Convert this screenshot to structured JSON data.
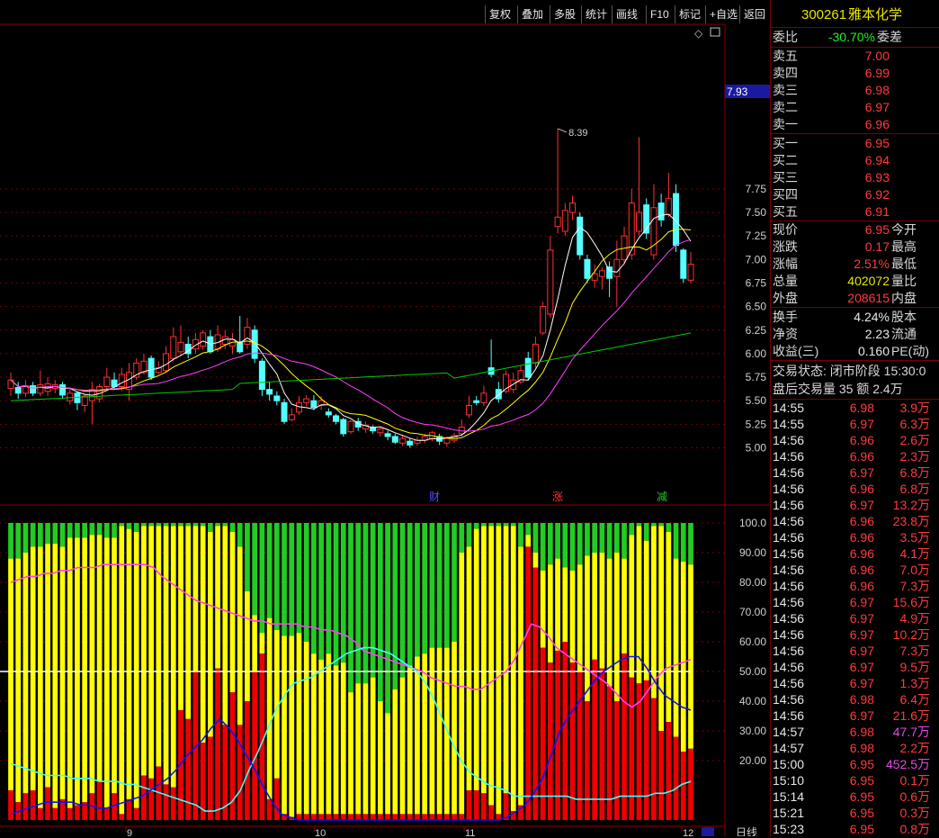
{
  "toolbar": {
    "buttons": [
      "复权",
      "叠加",
      "多股",
      "统计",
      "画线",
      "F10",
      "标记",
      "+自选",
      "返回"
    ]
  },
  "stock": {
    "code": "300261",
    "name": "雅本化学"
  },
  "quote": {
    "weibi_label": "委比",
    "weibi_value": "-30.70%",
    "weicha_label": "委差",
    "asks": [
      {
        "label": "卖五",
        "price": "7.00"
      },
      {
        "label": "卖四",
        "price": "6.99"
      },
      {
        "label": "卖三",
        "price": "6.98"
      },
      {
        "label": "卖二",
        "price": "6.97"
      },
      {
        "label": "卖一",
        "price": "6.96"
      }
    ],
    "bids": [
      {
        "label": "买一",
        "price": "6.95"
      },
      {
        "label": "买二",
        "price": "6.94"
      },
      {
        "label": "买三",
        "price": "6.93"
      },
      {
        "label": "买四",
        "price": "6.92"
      },
      {
        "label": "买五",
        "price": "6.91"
      }
    ],
    "stats1": [
      {
        "label": "现价",
        "value": "6.95",
        "label2": "今开",
        "cls": "red"
      },
      {
        "label": "涨跌",
        "value": "0.17",
        "label2": "最高",
        "cls": "red"
      },
      {
        "label": "涨幅",
        "value": "2.51%",
        "label2": "最低",
        "cls": "red"
      },
      {
        "label": "总量",
        "value": "402072",
        "label2": "量比",
        "cls": "yellow"
      },
      {
        "label": "外盘",
        "value": "208615",
        "label2": "内盘",
        "cls": "red"
      }
    ],
    "stats2": [
      {
        "label": "换手",
        "value": "4.24%",
        "label2": "股本",
        "cls": "white"
      },
      {
        "label": "净资",
        "value": "2.23",
        "label2": "流通",
        "cls": "white"
      },
      {
        "label": "收益(三)",
        "value": "0.160",
        "label2": "PE(动)",
        "cls": "white"
      }
    ],
    "trade_status": "交易状态: 闭市阶段 15:30:0",
    "after_hours": "盘后交易量 35 额 2.4万"
  },
  "ticks": [
    [
      "14:55",
      "6.98",
      "3.9万",
      "red"
    ],
    [
      "14:55",
      "6.97",
      "6.3万",
      "red"
    ],
    [
      "14:56",
      "6.96",
      "2.6万",
      "red"
    ],
    [
      "14:56",
      "6.96",
      "2.3万",
      "red"
    ],
    [
      "14:56",
      "6.97",
      "6.8万",
      "red"
    ],
    [
      "14:56",
      "6.96",
      "6.8万",
      "red"
    ],
    [
      "14:56",
      "6.97",
      "13.2万",
      "red"
    ],
    [
      "14:56",
      "6.96",
      "23.8万",
      "red"
    ],
    [
      "14:56",
      "6.96",
      "3.5万",
      "red"
    ],
    [
      "14:56",
      "6.96",
      "4.1万",
      "red"
    ],
    [
      "14:56",
      "6.96",
      "7.0万",
      "red"
    ],
    [
      "14:56",
      "6.96",
      "7.3万",
      "red"
    ],
    [
      "14:56",
      "6.97",
      "15.6万",
      "red"
    ],
    [
      "14:56",
      "6.97",
      "4.9万",
      "red"
    ],
    [
      "14:56",
      "6.97",
      "10.2万",
      "red"
    ],
    [
      "14:56",
      "6.97",
      "7.3万",
      "red"
    ],
    [
      "14:56",
      "6.97",
      "9.5万",
      "red"
    ],
    [
      "14:56",
      "6.97",
      "1.3万",
      "red"
    ],
    [
      "14:56",
      "6.98",
      "6.4万",
      "red"
    ],
    [
      "14:56",
      "6.97",
      "21.6万",
      "red"
    ],
    [
      "14:57",
      "6.98",
      "47.7万",
      "purple"
    ],
    [
      "14:57",
      "6.98",
      "2.2万",
      "red"
    ],
    [
      "15:00",
      "6.95",
      "452.5万",
      "purple"
    ],
    [
      "15:10",
      "6.95",
      "0.1万",
      "red"
    ],
    [
      "15:14",
      "6.95",
      "0.6万",
      "red"
    ],
    [
      "15:21",
      "6.95",
      "0.3万",
      "red"
    ],
    [
      "15:23",
      "6.95",
      "0.8万",
      "red"
    ]
  ],
  "main_chart": {
    "price_axis": [
      "7.75",
      "7.50",
      "7.25",
      "7.00",
      "6.75",
      "6.50",
      "6.25",
      "6.00",
      "5.75",
      "5.50",
      "5.25",
      "5.00"
    ],
    "current_price_tag": "7.93",
    "high_label": "8.39",
    "markers": [
      "财",
      "涨",
      "减"
    ]
  },
  "indicator_axis": [
    "100.0",
    "90.00",
    "80.00",
    "70.00",
    "60.00",
    "50.00",
    "40.00",
    "30.00",
    "20.00"
  ],
  "date_axis": [
    "9",
    "10",
    "11",
    "12"
  ],
  "period_label": "日线",
  "colors": {
    "up": "#ff3030",
    "down": "#54ffff",
    "grid": "#7a0000",
    "ma5": "#ffffff",
    "ma10": "#ffff00",
    "ma20": "#ff40ff",
    "ma60": "#00cc00"
  }
}
